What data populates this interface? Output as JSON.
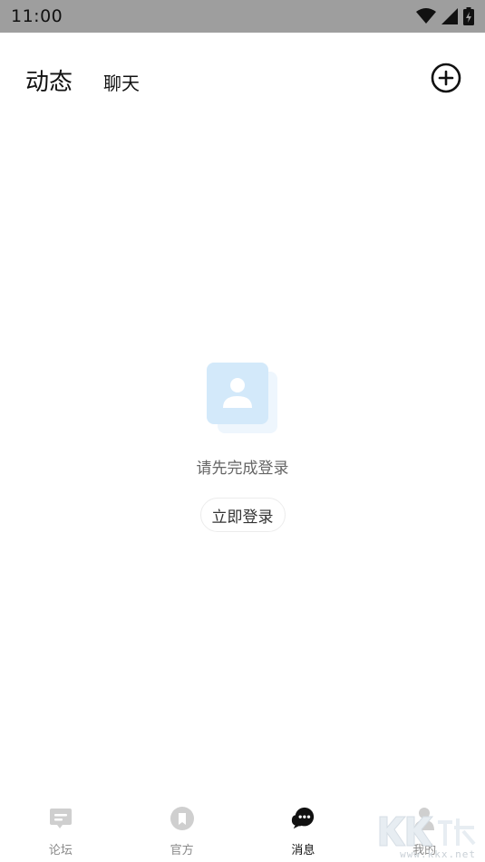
{
  "status_bar": {
    "time": "11:00",
    "icons": [
      "wifi-icon",
      "signal-icon",
      "battery-charging-icon"
    ]
  },
  "header": {
    "tabs": [
      {
        "label": "动态",
        "active": true
      },
      {
        "label": "聊天",
        "active": false
      }
    ],
    "add_icon": "plus-circle-icon"
  },
  "empty_state": {
    "illustration": "contact-card-icon",
    "message": "请先完成登录",
    "login_button": "立即登录"
  },
  "bottom_nav": {
    "items": [
      {
        "label": "论坛",
        "icon": "forum-icon",
        "active": false
      },
      {
        "label": "官方",
        "icon": "official-icon",
        "active": false
      },
      {
        "label": "消息",
        "icon": "message-icon",
        "active": true
      },
      {
        "label": "我的",
        "icon": "profile-icon",
        "active": false
      }
    ]
  },
  "watermark": {
    "text": "www.kkx.net"
  },
  "colors": {
    "status_bar_bg": "#9e9e9e",
    "inactive_icon": "#cfcfcf",
    "active_icon": "#111111",
    "illustration_blue": "#d6ebfb"
  }
}
